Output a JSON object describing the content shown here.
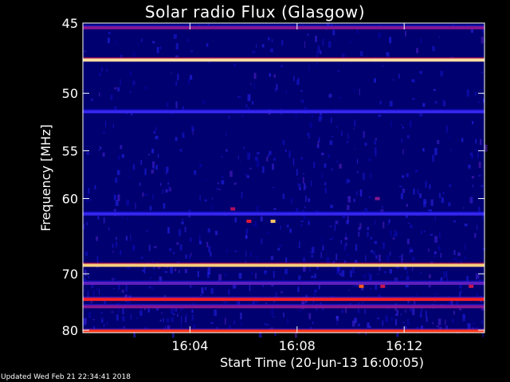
{
  "title": "Solar radio Flux (Glasgow)",
  "updated": "Updated Wed Feb 21 22:34:41 2018",
  "chart_data": {
    "type": "heatmap",
    "title": "Solar radio Flux (Glasgow)",
    "xlabel": "Start Time (20-Jun-13 16:00:05)",
    "ylabel": "Frequency [MHz]",
    "x_unit": "minutes after 16:00:05",
    "xlim": [
      0,
      15.0
    ],
    "ylim": [
      45,
      80.5
    ],
    "y_scale": "reciprocal",
    "x_ticks": [
      {
        "value": 4.0,
        "label": "16:04"
      },
      {
        "value": 8.0,
        "label": "16:08"
      },
      {
        "value": 12.0,
        "label": "16:12"
      }
    ],
    "y_ticks": [
      {
        "value": 45,
        "label": "45"
      },
      {
        "value": 50,
        "label": "50"
      },
      {
        "value": 55,
        "label": "55"
      },
      {
        "value": 60,
        "label": "60"
      },
      {
        "value": 70,
        "label": "70"
      },
      {
        "value": 80,
        "label": "80"
      }
    ],
    "colormap": [
      "#000010",
      "#0000a0",
      "#2828ff",
      "#b01060",
      "#ff2020",
      "#ff9a10",
      "#ffffe0"
    ],
    "background_color": "#000070",
    "bands": [
      {
        "freq": 45.3,
        "intensity": 0.45
      },
      {
        "freq": 47.5,
        "intensity": 0.95
      },
      {
        "freq": 51.5,
        "intensity": 0.35
      },
      {
        "freq": 61.8,
        "intensity": 0.35
      },
      {
        "freq": 68.7,
        "intensity": 0.92
      },
      {
        "freq": 71.5,
        "intensity": 0.4
      },
      {
        "freq": 74.2,
        "intensity": 0.65
      },
      {
        "freq": 75.5,
        "intensity": 0.45
      },
      {
        "freq": 80.2,
        "intensity": 0.7
      }
    ],
    "bursts": [
      {
        "time": 5.6,
        "freq": 61.2,
        "intensity": 0.5
      },
      {
        "time": 7.1,
        "freq": 62.7,
        "intensity": 0.9
      },
      {
        "time": 6.2,
        "freq": 62.7,
        "intensity": 0.6
      },
      {
        "time": 10.4,
        "freq": 72.0,
        "intensity": 0.75
      },
      {
        "time": 11.2,
        "freq": 72.0,
        "intensity": 0.55
      },
      {
        "time": 14.5,
        "freq": 72.0,
        "intensity": 0.55
      },
      {
        "time": 11.0,
        "freq": 60.0,
        "intensity": 0.45
      }
    ]
  }
}
